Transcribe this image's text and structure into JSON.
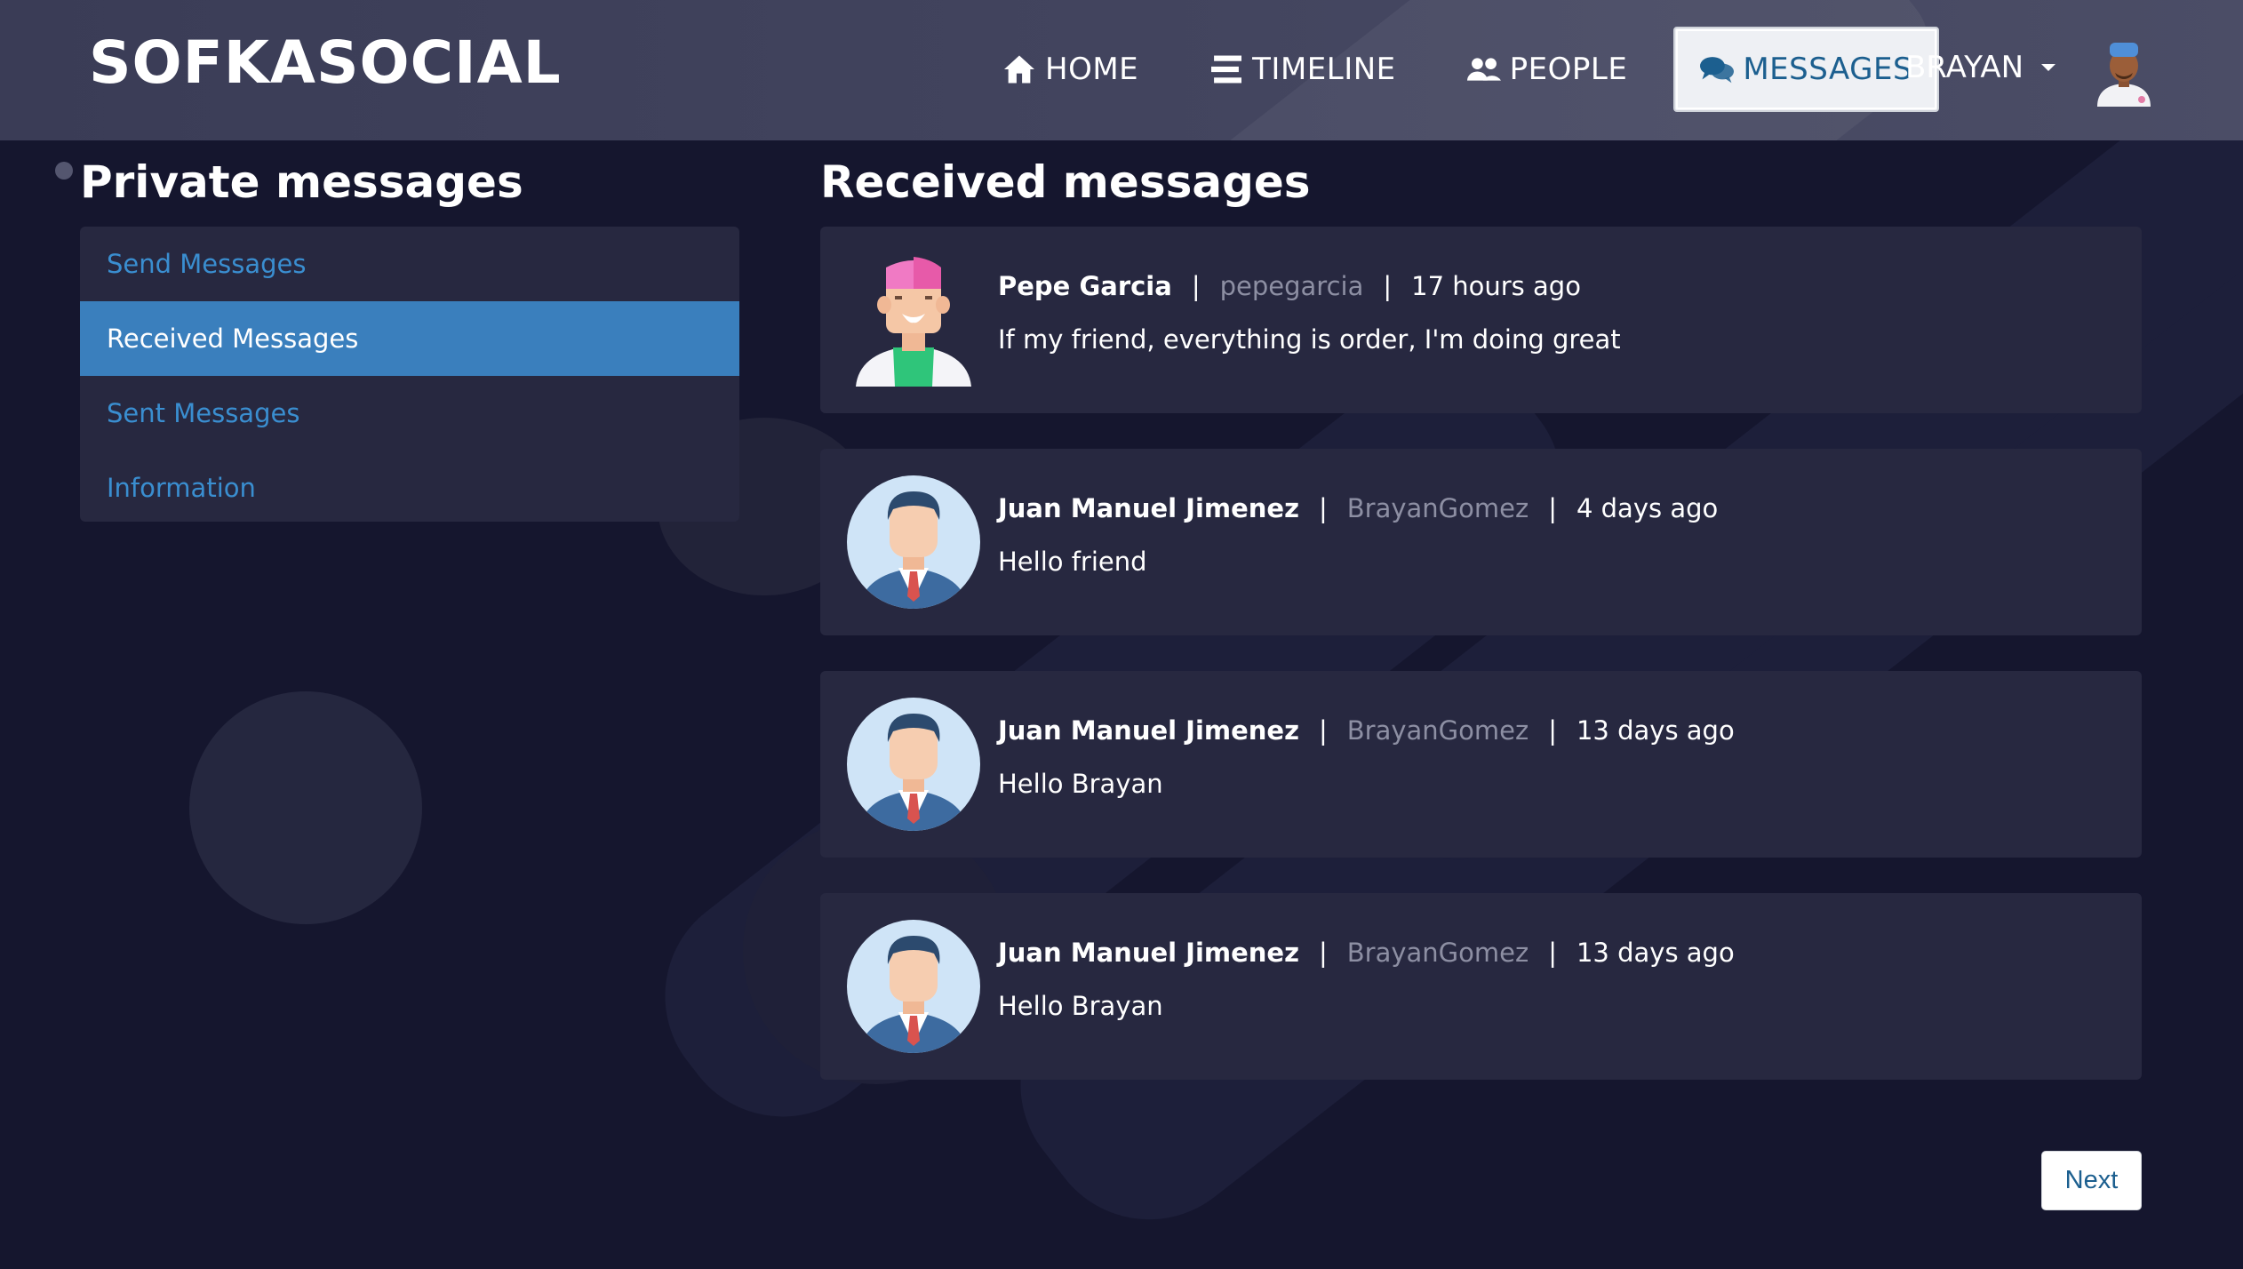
{
  "brand": "SOFKASOCIAL",
  "nav": {
    "items": [
      {
        "label": "HOME",
        "icon": "home-icon"
      },
      {
        "label": "TIMELINE",
        "icon": "timeline-icon"
      },
      {
        "label": "PEOPLE",
        "icon": "people-icon"
      },
      {
        "label": "MESSAGES",
        "icon": "messages-icon",
        "active": true
      }
    ],
    "user": "BRAYAN"
  },
  "sidebar": {
    "title": "Private messages",
    "items": [
      {
        "label": "Send Messages"
      },
      {
        "label": "Received Messages",
        "active": true
      },
      {
        "label": "Sent Messages"
      },
      {
        "label": "Information"
      }
    ]
  },
  "main": {
    "title": "Received messages",
    "messages": [
      {
        "sender": "Pepe Garcia",
        "username": "pepegarcia",
        "time": "17 hours ago",
        "text": "If my friend, everything is order, I'm doing great",
        "avatar": "pink-hair-avatar"
      },
      {
        "sender": "Juan Manuel Jimenez",
        "username": "BrayanGomez",
        "time": "4 days ago",
        "text": "Hello friend",
        "avatar": "businessman-avatar"
      },
      {
        "sender": "Juan Manuel Jimenez",
        "username": "BrayanGomez",
        "time": "13 days ago",
        "text": "Hello Brayan",
        "avatar": "businessman-avatar"
      },
      {
        "sender": "Juan Manuel Jimenez",
        "username": "BrayanGomez",
        "time": "13 days ago",
        "text": "Hello Brayan",
        "avatar": "businessman-avatar"
      }
    ],
    "next_label": "Next"
  },
  "colors": {
    "background": "#15162e",
    "card": "#272840",
    "accent": "#3a7fbd",
    "link": "#3a8ed0"
  }
}
